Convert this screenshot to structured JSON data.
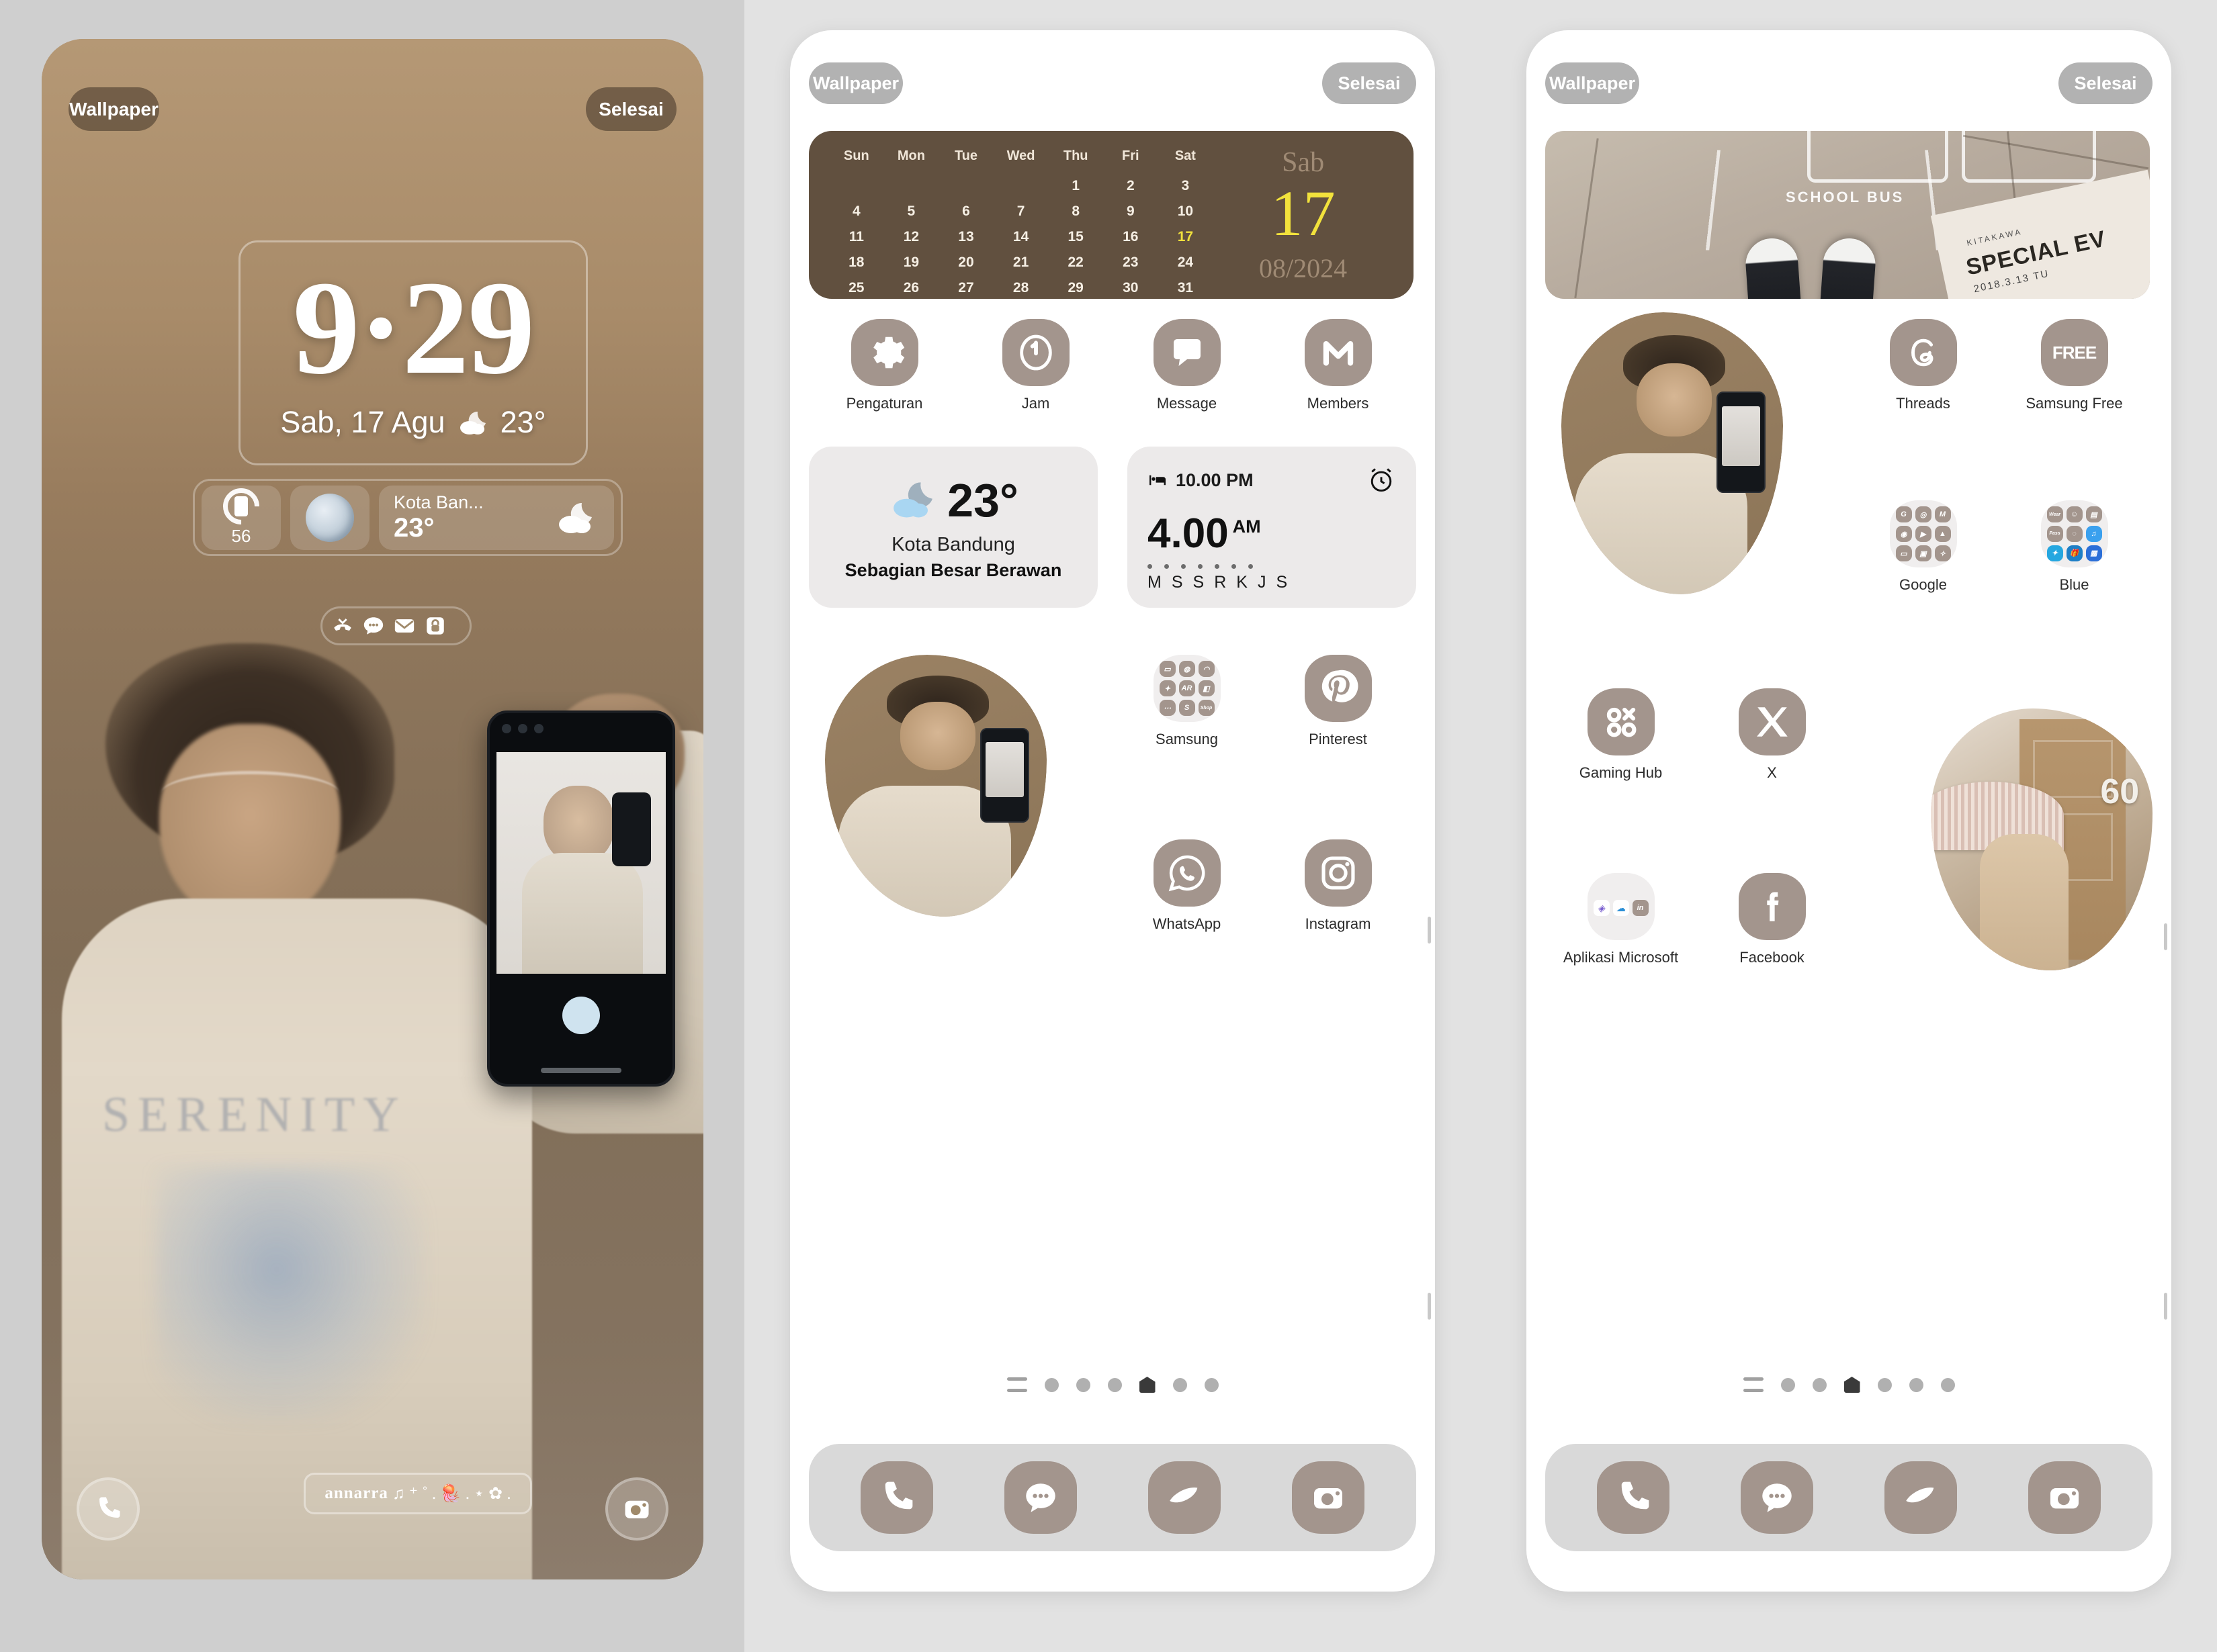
{
  "lock_screen": {
    "wallpaper_button": "Wallpaper",
    "done_button": "Selesai",
    "clock": "9·29",
    "date": "Sab, 17 Agu",
    "temp": "23°",
    "battery_level": "56",
    "weather_city_short": "Kota Ban...",
    "weather_temp_short": "23°",
    "notification_icons": [
      "missed-call-icon",
      "message-icon",
      "mail-icon",
      "lock-icon"
    ],
    "banner_text": "annarra",
    "banner_decor": "♫ ⁺ ˚ . 🪼 . ⋆ ✿ .",
    "shortcut_left": "phone-icon",
    "shortcut_right": "camera-icon"
  },
  "home_screen_1": {
    "wallpaper_button": "Wallpaper",
    "done_button": "Selesai",
    "calendar": {
      "weekday_headers": [
        "Sun",
        "Mon",
        "Tue",
        "Wed",
        "Thu",
        "Fri",
        "Sat"
      ],
      "weeks": [
        [
          "",
          "",
          "",
          "",
          "1",
          "2",
          "3"
        ],
        [
          "4",
          "5",
          "6",
          "7",
          "8",
          "9",
          "10"
        ],
        [
          "11",
          "12",
          "13",
          "14",
          "15",
          "16",
          "17"
        ],
        [
          "18",
          "19",
          "20",
          "21",
          "22",
          "23",
          "24"
        ],
        [
          "25",
          "26",
          "27",
          "28",
          "29",
          "30",
          "31"
        ]
      ],
      "today": "17",
      "day_name": "Sab",
      "day_number": "17",
      "month_year": "08/2024",
      "bg_color": "#61503f",
      "accent_color": "#f2e23c"
    },
    "apps_row1": [
      {
        "label": "Pengaturan",
        "icon": "gear-icon"
      },
      {
        "label": "Jam",
        "icon": "clock-icon"
      },
      {
        "label": "Message",
        "icon": "message-bubble-icon"
      },
      {
        "label": "Members",
        "icon": "members-m-icon"
      }
    ],
    "weather_widget": {
      "temp": "23°",
      "city": "Kota Bandung",
      "description": "Sebagian Besar Berawan",
      "icon": "moon-cloud-icon"
    },
    "alarm_widget": {
      "bedtime": "10.00 PM",
      "bedtime_icon": "bed-icon",
      "alarm_time": "4.00",
      "alarm_meridiem": "AM",
      "alarm_icon": "alarm-clock-icon",
      "days": [
        "M",
        "S",
        "S",
        "R",
        "K",
        "J",
        "S"
      ]
    },
    "apps_row2": [
      {
        "label": "Samsung",
        "icon": "samsung-folder-icon"
      },
      {
        "label": "Pinterest",
        "icon": "pinterest-icon"
      }
    ],
    "apps_row3": [
      {
        "label": "WhatsApp",
        "icon": "whatsapp-icon"
      },
      {
        "label": "Instagram",
        "icon": "instagram-icon"
      }
    ],
    "samsung_folder_items": [
      "files",
      "voice-recorder",
      "internet",
      "kids",
      "AR",
      "radio",
      "chat",
      "smartthings",
      "Shop"
    ],
    "page_indicator": {
      "pages": 6,
      "active_index": 3,
      "has_menu_icon": true
    },
    "dock": [
      {
        "icon": "phone-icon"
      },
      {
        "icon": "messages-icon"
      },
      {
        "icon": "internet-icon"
      },
      {
        "icon": "camera-icon"
      }
    ]
  },
  "home_screen_2": {
    "wallpaper_button": "Wallpaper",
    "done_button": "Selesai",
    "photo_banner": {
      "pavement_text": "SCHOOL BUS",
      "poster_brand": "KITAKAWA",
      "poster_title": "SPECIAL EV",
      "poster_date": "2018.3.13 TU"
    },
    "apps_row1": [
      {
        "label": "Threads",
        "icon": "threads-icon"
      },
      {
        "label": "Samsung Free",
        "icon": "samsung-free-icon",
        "glyph": "FREE"
      }
    ],
    "apps_row2": [
      {
        "label": "Google",
        "icon": "google-folder-icon"
      },
      {
        "label": "Blue",
        "icon": "blue-folder-icon"
      }
    ],
    "apps_row3": [
      {
        "label": "Gaming Hub",
        "icon": "gaming-hub-icon"
      },
      {
        "label": "X",
        "icon": "x-twitter-icon"
      }
    ],
    "apps_row4": [
      {
        "label": "Aplikasi Microsoft",
        "icon": "microsoft-folder-icon"
      },
      {
        "label": "Facebook",
        "icon": "facebook-icon"
      }
    ],
    "google_folder_items": [
      "G",
      "chrome",
      "gmail",
      "maps",
      "youtube",
      "drive",
      "meet",
      "duo",
      "photos"
    ],
    "blue_folder_items": [
      "Wear",
      "AR-emoji",
      "pass-lock",
      "Pass",
      "loading",
      "headphones",
      "kids",
      "gift",
      "secure"
    ],
    "microsoft_folder_items": [
      "copilot",
      "onedrive",
      "linkedin"
    ],
    "umbrella_photo": {
      "house_number": "60"
    },
    "page_indicator": {
      "pages": 6,
      "active_index": 3,
      "has_menu_icon": true
    },
    "dock": [
      {
        "icon": "phone-icon"
      },
      {
        "icon": "messages-icon"
      },
      {
        "icon": "internet-icon"
      },
      {
        "icon": "camera-icon"
      }
    ]
  }
}
